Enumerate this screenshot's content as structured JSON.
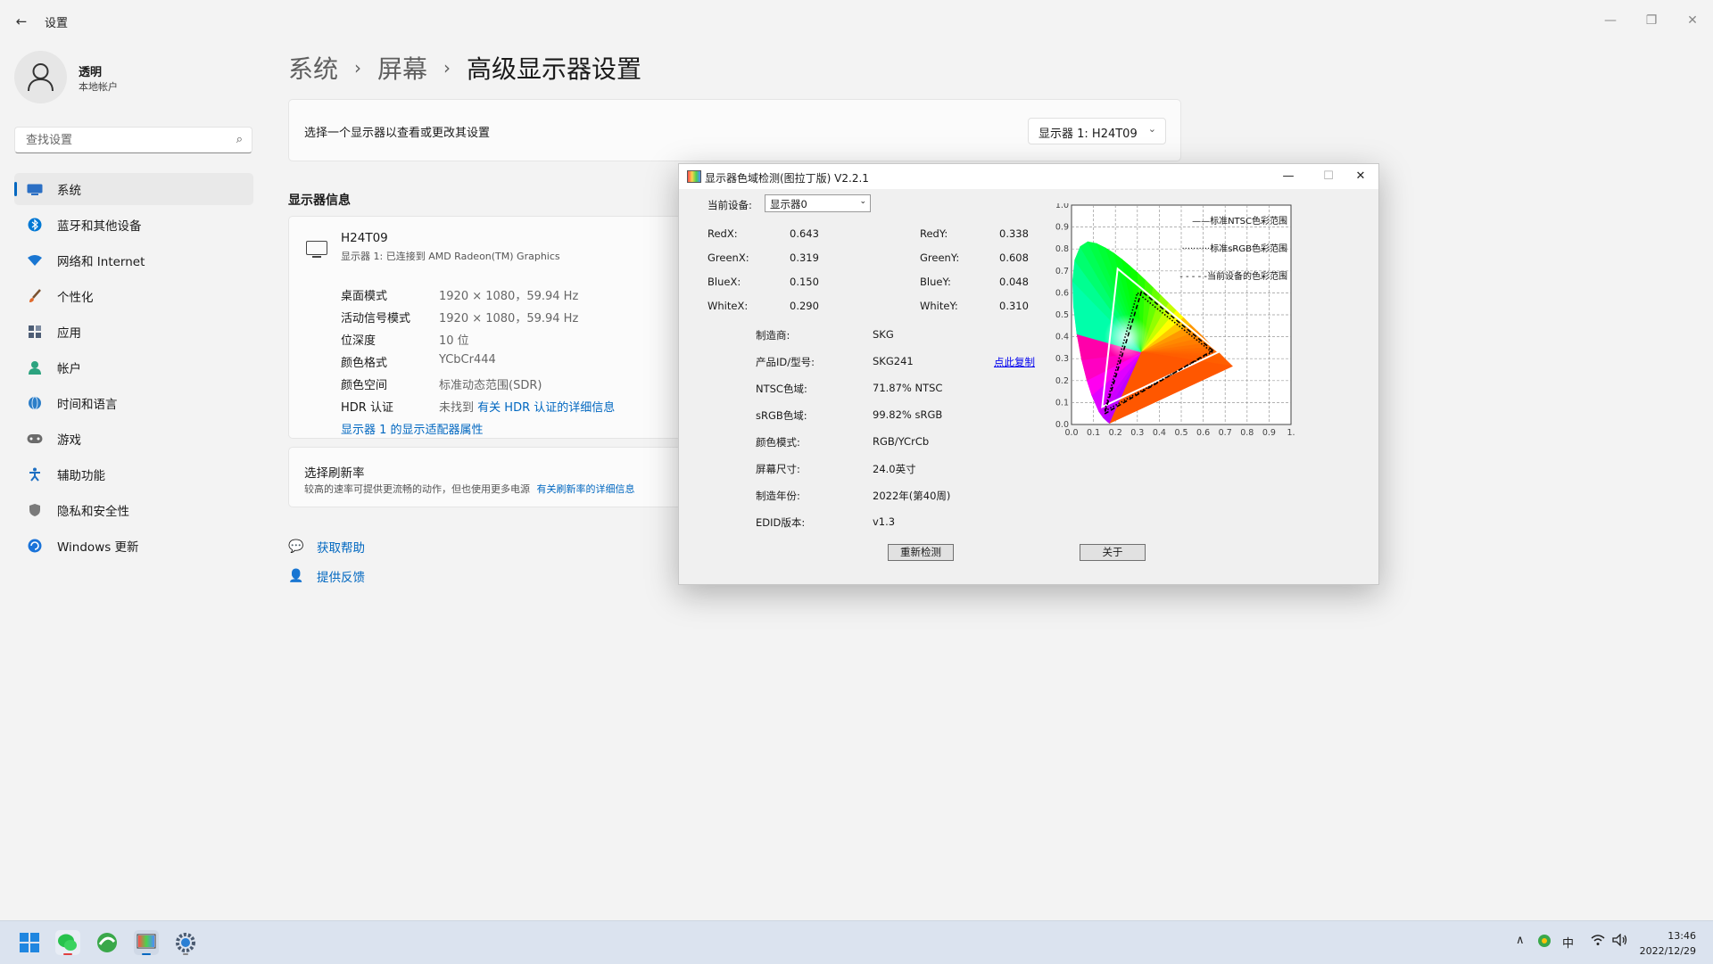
{
  "window": {
    "back_glyph": "←",
    "title": "设置",
    "controls": {
      "minimize": "—",
      "restore": "❐",
      "close": "✕"
    }
  },
  "user": {
    "name": "透明",
    "account_type": "本地帐户"
  },
  "search": {
    "placeholder": "查找设置",
    "icon": "search-icon"
  },
  "nav": [
    {
      "label": "系统",
      "icon": "system-icon",
      "color": "#2b6fc4",
      "selected": true
    },
    {
      "label": "蓝牙和其他设备",
      "icon": "bluetooth-icon",
      "color": "#0078d4",
      "selected": false
    },
    {
      "label": "网络和 Internet",
      "icon": "wifi-icon",
      "color": "#1976d2",
      "selected": false
    },
    {
      "label": "个性化",
      "icon": "brush-icon",
      "color": "#e0692b",
      "selected": false
    },
    {
      "label": "应用",
      "icon": "apps-icon",
      "color": "#4d5d75",
      "selected": false
    },
    {
      "label": "帐户",
      "icon": "account-icon",
      "color": "#2ca37f",
      "selected": false
    },
    {
      "label": "时间和语言",
      "icon": "globe-icon",
      "color": "#2b7ec8",
      "selected": false
    },
    {
      "label": "游戏",
      "icon": "gamepad-icon",
      "color": "#6b6b6b",
      "selected": false
    },
    {
      "label": "辅助功能",
      "icon": "accessibility-icon",
      "color": "#1e6fc2",
      "selected": false
    },
    {
      "label": "隐私和安全性",
      "icon": "shield-icon",
      "color": "#6b6b6b",
      "selected": false
    },
    {
      "label": "Windows 更新",
      "icon": "update-icon",
      "color": "#1a73d9",
      "selected": false
    }
  ],
  "breadcrumb": {
    "items": [
      "系统",
      "屏幕",
      "高级显示器设置"
    ],
    "separator": "›"
  },
  "select_display": {
    "label": "选择一个显示器以查看或更改其设置",
    "dropdown_value": "显示器 1: H24T09",
    "chevron": "⌄"
  },
  "display_info": {
    "heading": "显示器信息",
    "monitor_name": "H24T09",
    "monitor_sub": "显示器 1: 已连接到 AMD Radeon(TM) Graphics",
    "rows": [
      {
        "key": "桌面模式",
        "value": "1920 × 1080，59.94 Hz"
      },
      {
        "key": "活动信号模式",
        "value": "1920 × 1080，59.94 Hz"
      },
      {
        "key": "位深度",
        "value": "10 位"
      },
      {
        "key": "颜色格式",
        "value": "YCbCr444"
      },
      {
        "key": "颜色空间",
        "value": "标准动态范围(SDR)"
      }
    ],
    "hdr_key": "HDR 认证",
    "hdr_value": "未找到",
    "hdr_link": "有关 HDR 认证的详细信息",
    "adapter_link": "显示器 1 的显示适配器属性"
  },
  "refresh": {
    "title": "选择刷新率",
    "subtitle": "较高的速率可提供更流畅的动作，但也使用更多电源",
    "link": "有关刷新率的详细信息"
  },
  "help": {
    "get_help": "获取帮助",
    "feedback": "提供反馈"
  },
  "dialog": {
    "title": "显示器色域检测(图拉丁版) V2.2.1",
    "controls": {
      "minimize": "—",
      "maximize": "☐",
      "close": "✕"
    },
    "device_label": "当前设备:",
    "device_value": "显示器0",
    "device_chevron": "⌄",
    "coords": {
      "red_x_label": "RedX:",
      "red_x": "0.643",
      "red_y_label": "RedY:",
      "red_y": "0.338",
      "green_x_label": "GreenX:",
      "green_x": "0.319",
      "green_y_label": "GreenY:",
      "green_y": "0.608",
      "blue_x_label": "BlueX:",
      "blue_x": "0.150",
      "blue_y_label": "BlueY:",
      "blue_y": "0.048",
      "white_x_label": "WhiteX:",
      "white_x": "0.290",
      "white_y_label": "WhiteY:",
      "white_y": "0.310"
    },
    "fields": [
      {
        "key": "制造商:",
        "value": "SKG"
      },
      {
        "key": "产品ID/型号:",
        "value": "SKG241"
      },
      {
        "key": "NTSC色域:",
        "value": "71.87% NTSC"
      },
      {
        "key": "sRGB色域:",
        "value": "99.82% sRGB"
      },
      {
        "key": "颜色模式:",
        "value": "RGB/YCrCb"
      },
      {
        "key": "屏幕尺寸:",
        "value": "24.0英寸"
      },
      {
        "key": "制造年份:",
        "value": "2022年(第40周)"
      },
      {
        "key": "EDID版本:",
        "value": "v1.3"
      }
    ],
    "copy_link": "点此复制",
    "buttons": {
      "redetect": "重新检测",
      "about": "关于"
    }
  },
  "chart_data": {
    "type": "scatter",
    "title": "",
    "xlabel": "",
    "ylabel": "",
    "xlim": [
      0,
      1
    ],
    "ylim": [
      0,
      1
    ],
    "x_ticks": [
      "0.0",
      "0.1",
      "0.2",
      "0.3",
      "0.4",
      "0.5",
      "0.6",
      "0.7",
      "0.8",
      "0.9",
      "1."
    ],
    "y_ticks": [
      "0.0",
      "0.1",
      "0.2",
      "0.3",
      "0.4",
      "0.5",
      "0.6",
      "0.7",
      "0.8",
      "0.9",
      "1.0"
    ],
    "grid": true,
    "legend_position": "top-right",
    "spectral_locus": [
      [
        0.175,
        0.005
      ],
      [
        0.174,
        0.005
      ],
      [
        0.172,
        0.005
      ],
      [
        0.166,
        0.009
      ],
      [
        0.144,
        0.03
      ],
      [
        0.124,
        0.058
      ],
      [
        0.091,
        0.133
      ],
      [
        0.069,
        0.201
      ],
      [
        0.045,
        0.295
      ],
      [
        0.023,
        0.413
      ],
      [
        0.008,
        0.538
      ],
      [
        0.004,
        0.655
      ],
      [
        0.014,
        0.75
      ],
      [
        0.039,
        0.812
      ],
      [
        0.074,
        0.834
      ],
      [
        0.114,
        0.826
      ],
      [
        0.155,
        0.806
      ],
      [
        0.193,
        0.782
      ],
      [
        0.23,
        0.754
      ],
      [
        0.266,
        0.724
      ],
      [
        0.302,
        0.692
      ],
      [
        0.337,
        0.659
      ],
      [
        0.373,
        0.624
      ],
      [
        0.408,
        0.589
      ],
      [
        0.444,
        0.554
      ],
      [
        0.479,
        0.52
      ],
      [
        0.512,
        0.487
      ],
      [
        0.544,
        0.455
      ],
      [
        0.575,
        0.425
      ],
      [
        0.603,
        0.397
      ],
      [
        0.627,
        0.372
      ],
      [
        0.648,
        0.351
      ],
      [
        0.666,
        0.334
      ],
      [
        0.68,
        0.32
      ],
      [
        0.691,
        0.309
      ],
      [
        0.7,
        0.3
      ],
      [
        0.735,
        0.265
      ]
    ],
    "series": [
      {
        "name": "标准NTSC色彩范围",
        "style": "solid",
        "color": "#ffffff",
        "points": [
          [
            0.67,
            0.33
          ],
          [
            0.21,
            0.71
          ],
          [
            0.14,
            0.08
          ]
        ]
      },
      {
        "name": "标准sRGB色彩范围",
        "style": "dotted",
        "color": "#000000",
        "points": [
          [
            0.64,
            0.33
          ],
          [
            0.3,
            0.6
          ],
          [
            0.15,
            0.06
          ]
        ]
      },
      {
        "name": "当前设备的色彩范围",
        "style": "dashed",
        "color": "#000000",
        "points": [
          [
            0.643,
            0.338
          ],
          [
            0.319,
            0.608
          ],
          [
            0.15,
            0.048
          ]
        ]
      }
    ],
    "legend_labels": [
      "——标准NTSC色彩范围",
      "··········标准sRGB色彩范围",
      "- - - - -当前设备的色彩范围"
    ]
  },
  "taskbar": {
    "apps": [
      {
        "icon": "start-icon"
      },
      {
        "icon": "wechat-icon"
      },
      {
        "icon": "browser-icon"
      },
      {
        "icon": "gamut-app-icon"
      },
      {
        "icon": "settings-icon"
      }
    ],
    "tray": {
      "chevron": "∧",
      "ime": "中",
      "wifi": "wifi-icon",
      "volume": "volume-icon"
    },
    "time": "13:46",
    "date": "2022/12/29"
  }
}
